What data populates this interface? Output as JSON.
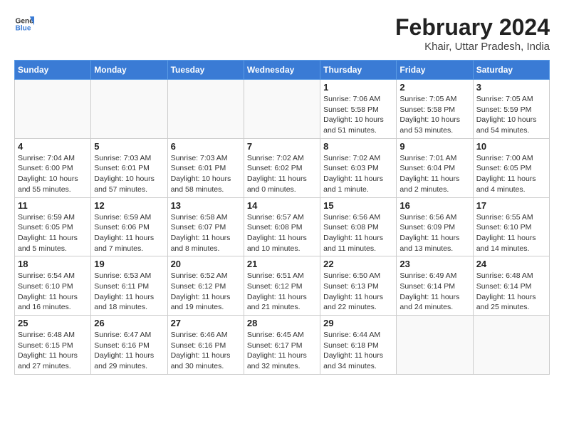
{
  "header": {
    "logo_general": "General",
    "logo_blue": "Blue",
    "month_title": "February 2024",
    "location": "Khair, Uttar Pradesh, India"
  },
  "weekdays": [
    "Sunday",
    "Monday",
    "Tuesday",
    "Wednesday",
    "Thursday",
    "Friday",
    "Saturday"
  ],
  "weeks": [
    [
      {
        "day": "",
        "info": ""
      },
      {
        "day": "",
        "info": ""
      },
      {
        "day": "",
        "info": ""
      },
      {
        "day": "",
        "info": ""
      },
      {
        "day": "1",
        "info": "Sunrise: 7:06 AM\nSunset: 5:58 PM\nDaylight: 10 hours\nand 51 minutes."
      },
      {
        "day": "2",
        "info": "Sunrise: 7:05 AM\nSunset: 5:58 PM\nDaylight: 10 hours\nand 53 minutes."
      },
      {
        "day": "3",
        "info": "Sunrise: 7:05 AM\nSunset: 5:59 PM\nDaylight: 10 hours\nand 54 minutes."
      }
    ],
    [
      {
        "day": "4",
        "info": "Sunrise: 7:04 AM\nSunset: 6:00 PM\nDaylight: 10 hours\nand 55 minutes."
      },
      {
        "day": "5",
        "info": "Sunrise: 7:03 AM\nSunset: 6:01 PM\nDaylight: 10 hours\nand 57 minutes."
      },
      {
        "day": "6",
        "info": "Sunrise: 7:03 AM\nSunset: 6:01 PM\nDaylight: 10 hours\nand 58 minutes."
      },
      {
        "day": "7",
        "info": "Sunrise: 7:02 AM\nSunset: 6:02 PM\nDaylight: 11 hours\nand 0 minutes."
      },
      {
        "day": "8",
        "info": "Sunrise: 7:02 AM\nSunset: 6:03 PM\nDaylight: 11 hours\nand 1 minute."
      },
      {
        "day": "9",
        "info": "Sunrise: 7:01 AM\nSunset: 6:04 PM\nDaylight: 11 hours\nand 2 minutes."
      },
      {
        "day": "10",
        "info": "Sunrise: 7:00 AM\nSunset: 6:05 PM\nDaylight: 11 hours\nand 4 minutes."
      }
    ],
    [
      {
        "day": "11",
        "info": "Sunrise: 6:59 AM\nSunset: 6:05 PM\nDaylight: 11 hours\nand 5 minutes."
      },
      {
        "day": "12",
        "info": "Sunrise: 6:59 AM\nSunset: 6:06 PM\nDaylight: 11 hours\nand 7 minutes."
      },
      {
        "day": "13",
        "info": "Sunrise: 6:58 AM\nSunset: 6:07 PM\nDaylight: 11 hours\nand 8 minutes."
      },
      {
        "day": "14",
        "info": "Sunrise: 6:57 AM\nSunset: 6:08 PM\nDaylight: 11 hours\nand 10 minutes."
      },
      {
        "day": "15",
        "info": "Sunrise: 6:56 AM\nSunset: 6:08 PM\nDaylight: 11 hours\nand 11 minutes."
      },
      {
        "day": "16",
        "info": "Sunrise: 6:56 AM\nSunset: 6:09 PM\nDaylight: 11 hours\nand 13 minutes."
      },
      {
        "day": "17",
        "info": "Sunrise: 6:55 AM\nSunset: 6:10 PM\nDaylight: 11 hours\nand 14 minutes."
      }
    ],
    [
      {
        "day": "18",
        "info": "Sunrise: 6:54 AM\nSunset: 6:10 PM\nDaylight: 11 hours\nand 16 minutes."
      },
      {
        "day": "19",
        "info": "Sunrise: 6:53 AM\nSunset: 6:11 PM\nDaylight: 11 hours\nand 18 minutes."
      },
      {
        "day": "20",
        "info": "Sunrise: 6:52 AM\nSunset: 6:12 PM\nDaylight: 11 hours\nand 19 minutes."
      },
      {
        "day": "21",
        "info": "Sunrise: 6:51 AM\nSunset: 6:12 PM\nDaylight: 11 hours\nand 21 minutes."
      },
      {
        "day": "22",
        "info": "Sunrise: 6:50 AM\nSunset: 6:13 PM\nDaylight: 11 hours\nand 22 minutes."
      },
      {
        "day": "23",
        "info": "Sunrise: 6:49 AM\nSunset: 6:14 PM\nDaylight: 11 hours\nand 24 minutes."
      },
      {
        "day": "24",
        "info": "Sunrise: 6:48 AM\nSunset: 6:14 PM\nDaylight: 11 hours\nand 25 minutes."
      }
    ],
    [
      {
        "day": "25",
        "info": "Sunrise: 6:48 AM\nSunset: 6:15 PM\nDaylight: 11 hours\nand 27 minutes."
      },
      {
        "day": "26",
        "info": "Sunrise: 6:47 AM\nSunset: 6:16 PM\nDaylight: 11 hours\nand 29 minutes."
      },
      {
        "day": "27",
        "info": "Sunrise: 6:46 AM\nSunset: 6:16 PM\nDaylight: 11 hours\nand 30 minutes."
      },
      {
        "day": "28",
        "info": "Sunrise: 6:45 AM\nSunset: 6:17 PM\nDaylight: 11 hours\nand 32 minutes."
      },
      {
        "day": "29",
        "info": "Sunrise: 6:44 AM\nSunset: 6:18 PM\nDaylight: 11 hours\nand 34 minutes."
      },
      {
        "day": "",
        "info": ""
      },
      {
        "day": "",
        "info": ""
      }
    ]
  ]
}
